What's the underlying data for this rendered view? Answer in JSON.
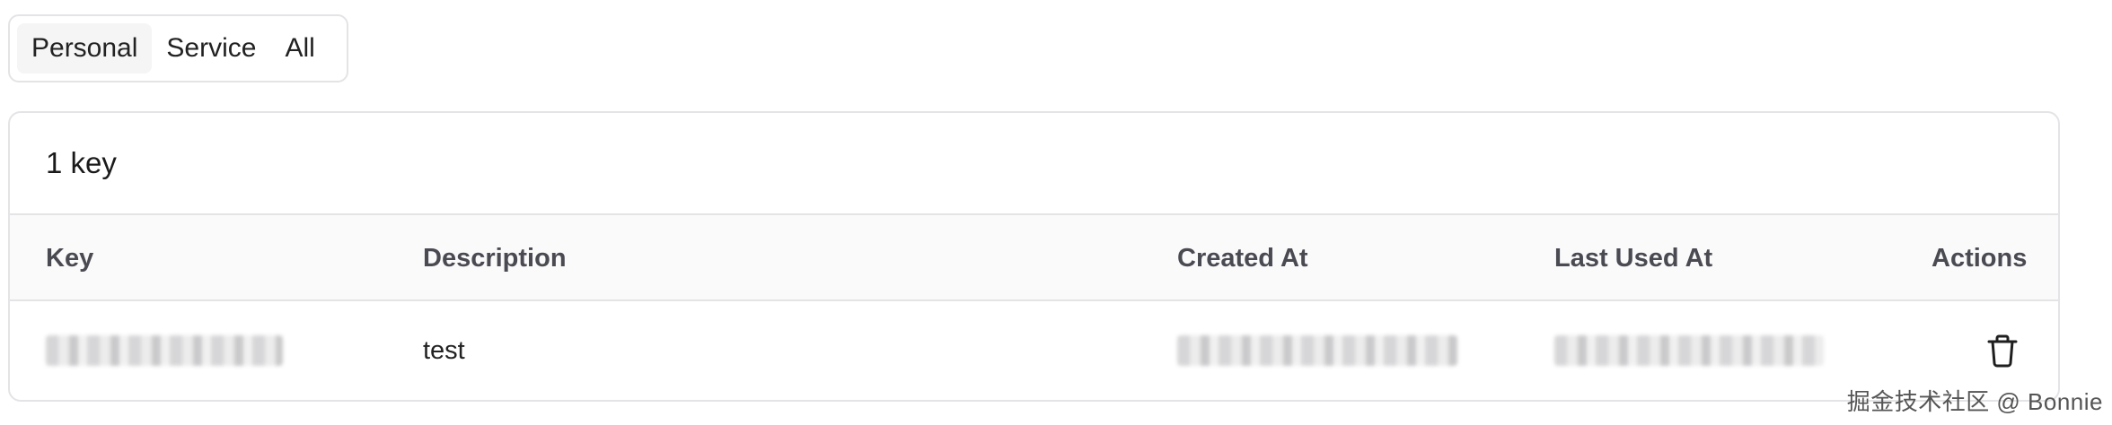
{
  "tabs": [
    {
      "label": "Personal",
      "active": true
    },
    {
      "label": "Service",
      "active": false
    },
    {
      "label": "All",
      "active": false
    }
  ],
  "card": {
    "count_label": "1 key"
  },
  "table": {
    "headers": {
      "key": "Key",
      "description": "Description",
      "created_at": "Created At",
      "last_used_at": "Last Used At",
      "actions": "Actions"
    },
    "rows": [
      {
        "description": "test",
        "delete_icon": "trash-icon"
      }
    ]
  },
  "watermark": "掘金技术社区 @ Bonnie",
  "colors": {
    "border": "#e4e4e7",
    "header_bg": "#fafafa",
    "active_tab_bg": "#f5f5f5"
  }
}
